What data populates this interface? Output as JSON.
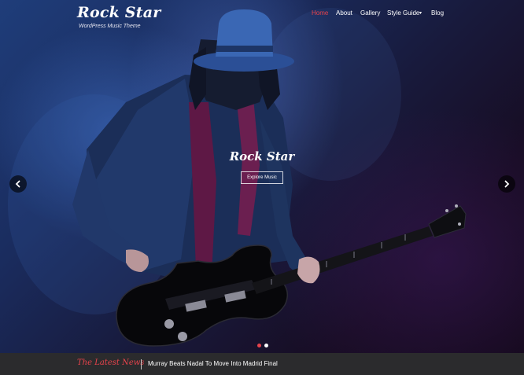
{
  "site": {
    "title": "Rock Star",
    "tagline": "WordPress Music Theme"
  },
  "nav": {
    "items": [
      {
        "label": "Home",
        "active": true
      },
      {
        "label": "About",
        "active": false
      },
      {
        "label": "Gallery",
        "active": false
      },
      {
        "label": "Style Guide",
        "active": false,
        "has_submenu": true
      },
      {
        "label": "Blog",
        "active": false
      }
    ]
  },
  "slider": {
    "title": "Rock Star",
    "button_label": "Explore Music",
    "prev_icon": "chevron-left-icon",
    "next_icon": "chevron-right-icon",
    "dots": 2,
    "active_dot": 1,
    "image": "guitarist-in-hat-playing-electric-guitar"
  },
  "news": {
    "label": "The Latest News",
    "headline": "Murray Beats Nadal To Move Into Madrid Final"
  },
  "colors": {
    "accent": "#e8434c",
    "news_bar": "#2b2b2d",
    "text": "#ffffff"
  }
}
